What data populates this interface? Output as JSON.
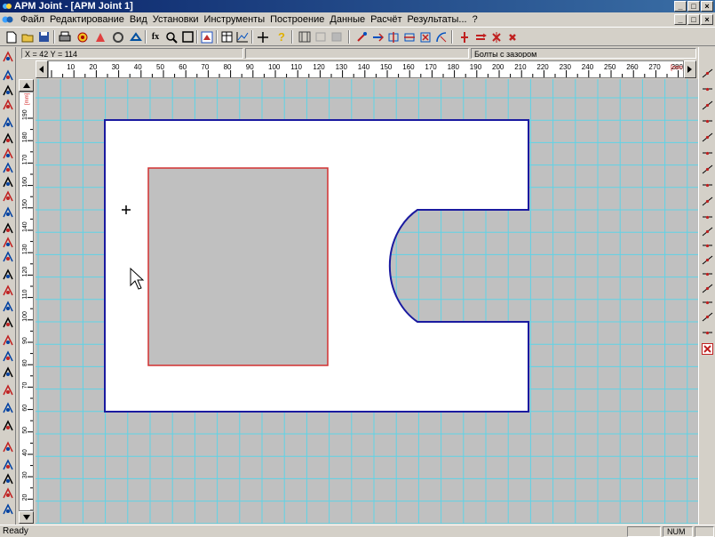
{
  "window": {
    "title": "APM Joint - [APM Joint 1]",
    "controls": [
      "_",
      "□",
      "×"
    ]
  },
  "menu": {
    "items": [
      "Файл",
      "Редактирование",
      "Вид",
      "Установки",
      "Инструменты",
      "Построение",
      "Данные",
      "Расчёт",
      "Результаты...",
      "?"
    ],
    "mdi_controls": [
      "_",
      "□",
      "×"
    ]
  },
  "coords": {
    "position": "X = 42  Y = 114",
    "joint_type": "Болты с зазором"
  },
  "ruler": {
    "h_labels": [
      "10",
      "20",
      "30",
      "40",
      "50",
      "60",
      "70",
      "80",
      "90",
      "100",
      "110",
      "120",
      "130",
      "140",
      "150",
      "160",
      "170",
      "180",
      "190",
      "200",
      "210",
      "220",
      "230",
      "240",
      "250",
      "260",
      "270",
      "280"
    ],
    "v_labels": [
      "190",
      "180",
      "170",
      "160",
      "150",
      "140",
      "130",
      "120",
      "110",
      "100",
      "90",
      "80",
      "70",
      "60",
      "50",
      "40",
      "30",
      "20",
      "10"
    ],
    "unit": "[mm]"
  },
  "status": {
    "text": "Ready",
    "num": "NUM"
  },
  "colors": {
    "grid": "#5fd3e6",
    "outer_outline": "#1a1aa0",
    "inner_outline": "#d23030",
    "canvas_bg": "#c0c0c0",
    "plate_fill": "#ffffff"
  }
}
